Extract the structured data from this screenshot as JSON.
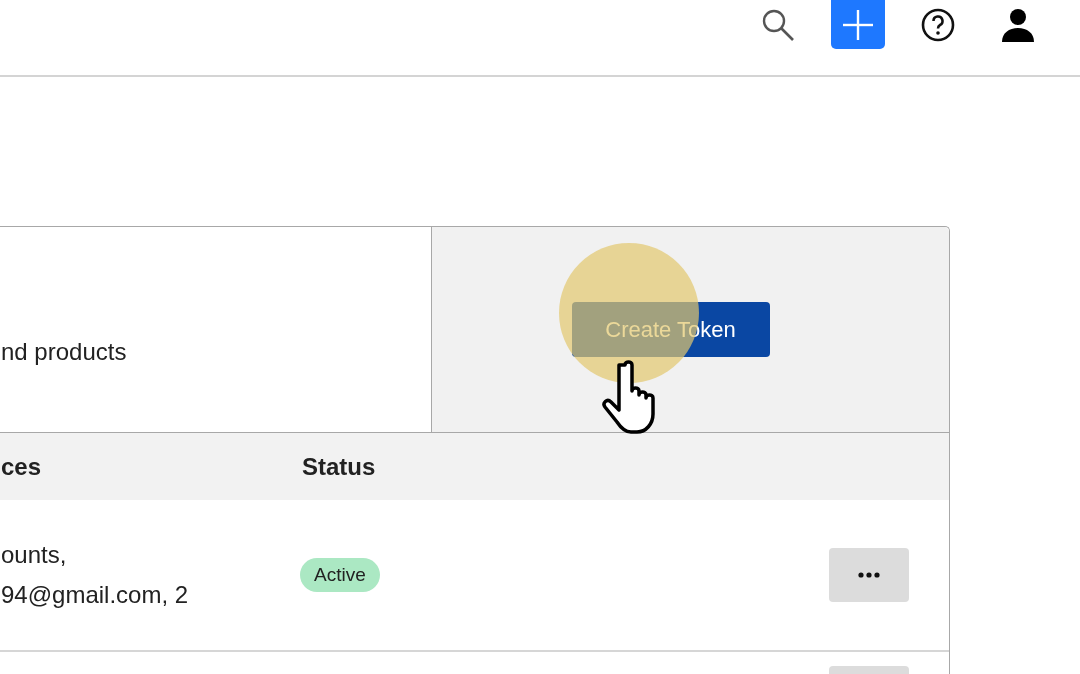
{
  "header": {
    "icons": [
      {
        "kind": "search"
      },
      {
        "kind": "add"
      },
      {
        "kind": "help"
      },
      {
        "kind": "user"
      }
    ]
  },
  "card": {
    "description": "nd products",
    "button": "Create Token",
    "click_highlight": true
  },
  "table": {
    "columns": [
      "ces",
      "Status"
    ],
    "rows": [
      {
        "kind": "token",
        "resources": [
          "ounts,",
          "94@gmail.com, 2"
        ],
        "status": "Active"
      },
      {
        "kind": "clipped"
      }
    ]
  }
}
